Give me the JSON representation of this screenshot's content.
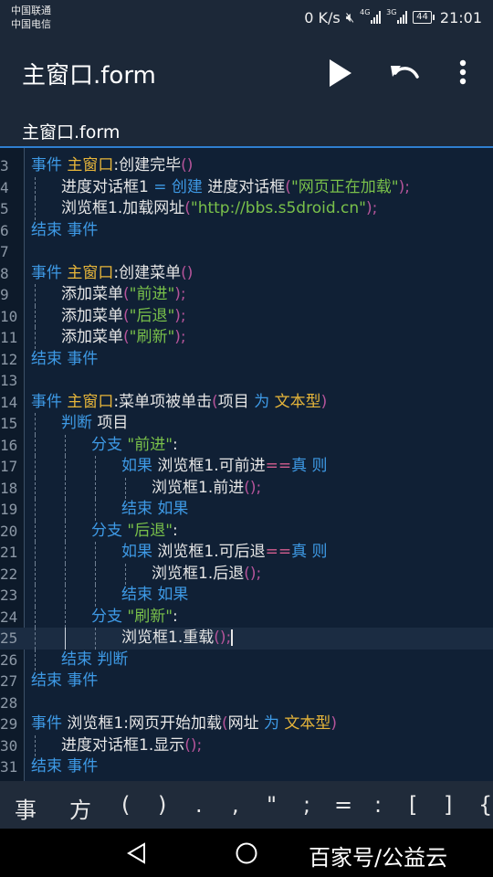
{
  "status_bar": {
    "carrier1": "中国联通",
    "carrier2": "中国电信",
    "speed": "0 K/s",
    "net1": "4G",
    "net2": "3G",
    "battery": "44",
    "time": "21:01"
  },
  "app_bar": {
    "title": "主窗口.form",
    "run_icon": "play-icon",
    "undo_icon": "undo-icon",
    "more_icon": "more-vert-icon"
  },
  "tabs": [
    {
      "label": "主窗口.form",
      "active": true
    }
  ],
  "editor": {
    "current_line": 25,
    "lines": [
      {
        "n": "3",
        "indent": 0,
        "tokens": [
          [
            "kw",
            "事件"
          ],
          [
            "df",
            " "
          ],
          [
            "cls",
            "主窗口"
          ],
          [
            "df",
            ":创建完毕"
          ],
          [
            "pu",
            "()"
          ]
        ]
      },
      {
        "n": "4",
        "indent": 1,
        "tokens": [
          [
            "df",
            "进度对话框1 "
          ],
          [
            "kw",
            "= 创建"
          ],
          [
            "df",
            " 进度对话框"
          ],
          [
            "pu",
            "("
          ],
          [
            "str",
            "\"网页正在加载\""
          ],
          [
            "pu",
            ");"
          ]
        ]
      },
      {
        "n": "5",
        "indent": 1,
        "tokens": [
          [
            "df",
            "浏览框1.加载网址"
          ],
          [
            "pu",
            "("
          ],
          [
            "str",
            "\"http://bbs.s5droid.cn\""
          ],
          [
            "pu",
            ");"
          ]
        ]
      },
      {
        "n": "6",
        "indent": 0,
        "tokens": [
          [
            "kw",
            "结束 事件"
          ]
        ]
      },
      {
        "n": "7",
        "indent": 0,
        "tokens": []
      },
      {
        "n": "8",
        "indent": 0,
        "tokens": [
          [
            "kw",
            "事件"
          ],
          [
            "df",
            " "
          ],
          [
            "cls",
            "主窗口"
          ],
          [
            "df",
            ":创建菜单"
          ],
          [
            "pu",
            "()"
          ]
        ]
      },
      {
        "n": "9",
        "indent": 1,
        "tokens": [
          [
            "df",
            "添加菜单"
          ],
          [
            "pu",
            "("
          ],
          [
            "str",
            "\"前进\""
          ],
          [
            "pu",
            ");"
          ]
        ]
      },
      {
        "n": "10",
        "indent": 1,
        "tokens": [
          [
            "df",
            "添加菜单"
          ],
          [
            "pu",
            "("
          ],
          [
            "str",
            "\"后退\""
          ],
          [
            "pu",
            ");"
          ]
        ]
      },
      {
        "n": "11",
        "indent": 1,
        "tokens": [
          [
            "df",
            "添加菜单"
          ],
          [
            "pu",
            "("
          ],
          [
            "str",
            "\"刷新\""
          ],
          [
            "pu",
            ");"
          ]
        ]
      },
      {
        "n": "12",
        "indent": 0,
        "tokens": [
          [
            "kw",
            "结束 事件"
          ]
        ]
      },
      {
        "n": "13",
        "indent": 0,
        "tokens": []
      },
      {
        "n": "14",
        "indent": 0,
        "tokens": [
          [
            "kw",
            "事件"
          ],
          [
            "df",
            " "
          ],
          [
            "cls",
            "主窗口"
          ],
          [
            "df",
            ":菜单项被单击"
          ],
          [
            "pu",
            "("
          ],
          [
            "df",
            "项目 "
          ],
          [
            "kw",
            "为"
          ],
          [
            "df",
            " "
          ],
          [
            "cls",
            "文本型"
          ],
          [
            "pu",
            ")"
          ]
        ]
      },
      {
        "n": "15",
        "indent": 1,
        "tokens": [
          [
            "kw",
            "判断"
          ],
          [
            "df",
            " 项目"
          ]
        ]
      },
      {
        "n": "16",
        "indent": 2,
        "tokens": [
          [
            "kw",
            "分支"
          ],
          [
            "df",
            " "
          ],
          [
            "str",
            "\"前进\""
          ],
          [
            "df",
            ":"
          ]
        ]
      },
      {
        "n": "17",
        "indent": 3,
        "tokens": [
          [
            "kw",
            "如果"
          ],
          [
            "df",
            " 浏览框1.可前进"
          ],
          [
            "op",
            "=="
          ],
          [
            "kw",
            "真 则"
          ]
        ]
      },
      {
        "n": "18",
        "indent": 4,
        "tokens": [
          [
            "df",
            "浏览框1.前进"
          ],
          [
            "pu",
            "();"
          ]
        ]
      },
      {
        "n": "19",
        "indent": 3,
        "tokens": [
          [
            "kw",
            "结束 如果"
          ]
        ]
      },
      {
        "n": "20",
        "indent": 2,
        "tokens": [
          [
            "kw",
            "分支"
          ],
          [
            "df",
            " "
          ],
          [
            "str",
            "\"后退\""
          ],
          [
            "df",
            ":"
          ]
        ]
      },
      {
        "n": "21",
        "indent": 3,
        "tokens": [
          [
            "kw",
            "如果"
          ],
          [
            "df",
            " 浏览框1.可后退"
          ],
          [
            "op",
            "=="
          ],
          [
            "kw",
            "真 则"
          ]
        ]
      },
      {
        "n": "22",
        "indent": 4,
        "tokens": [
          [
            "df",
            "浏览框1.后退"
          ],
          [
            "pu",
            "();"
          ]
        ]
      },
      {
        "n": "23",
        "indent": 3,
        "tokens": [
          [
            "kw",
            "结束 如果"
          ]
        ]
      },
      {
        "n": "24",
        "indent": 2,
        "tokens": [
          [
            "kw",
            "分支"
          ],
          [
            "df",
            " "
          ],
          [
            "str",
            "\"刷新\""
          ],
          [
            "df",
            ":"
          ]
        ]
      },
      {
        "n": "25",
        "indent": 3,
        "tokens": [
          [
            "df",
            "浏览框1.重载"
          ],
          [
            "pu",
            "();"
          ]
        ]
      },
      {
        "n": "26",
        "indent": 1,
        "tokens": [
          [
            "kw",
            "结束 判断"
          ]
        ]
      },
      {
        "n": "27",
        "indent": 0,
        "tokens": [
          [
            "kw",
            "结束 事件"
          ]
        ]
      },
      {
        "n": "28",
        "indent": 0,
        "tokens": []
      },
      {
        "n": "29",
        "indent": 0,
        "tokens": [
          [
            "kw",
            "事件"
          ],
          [
            "df",
            " 浏览框1:网页开始加载"
          ],
          [
            "pu",
            "("
          ],
          [
            "df",
            "网址 "
          ],
          [
            "kw",
            "为"
          ],
          [
            "df",
            " "
          ],
          [
            "cls",
            "文本型"
          ],
          [
            "pu",
            ")"
          ]
        ]
      },
      {
        "n": "30",
        "indent": 1,
        "tokens": [
          [
            "df",
            "进度对话框1.显示"
          ],
          [
            "pu",
            "();"
          ]
        ]
      },
      {
        "n": "31",
        "indent": 0,
        "tokens": [
          [
            "kw",
            "结束 事件"
          ]
        ]
      }
    ]
  },
  "symbol_bar": [
    "事",
    "方",
    "(",
    ")",
    ".",
    ",",
    "\"",
    ";",
    "=",
    ":",
    "[",
    "]",
    "{"
  ],
  "nav_bar": {
    "back_icon": "back-triangle-icon",
    "home_icon": "home-circle-icon",
    "watermark": "百家号/公益云"
  },
  "colors": {
    "keyword": "#3e9ae6",
    "class_name": "#e6b53a",
    "string": "#79c04a",
    "punctuation": "#b5549a",
    "accent": "#2f7fd0"
  }
}
